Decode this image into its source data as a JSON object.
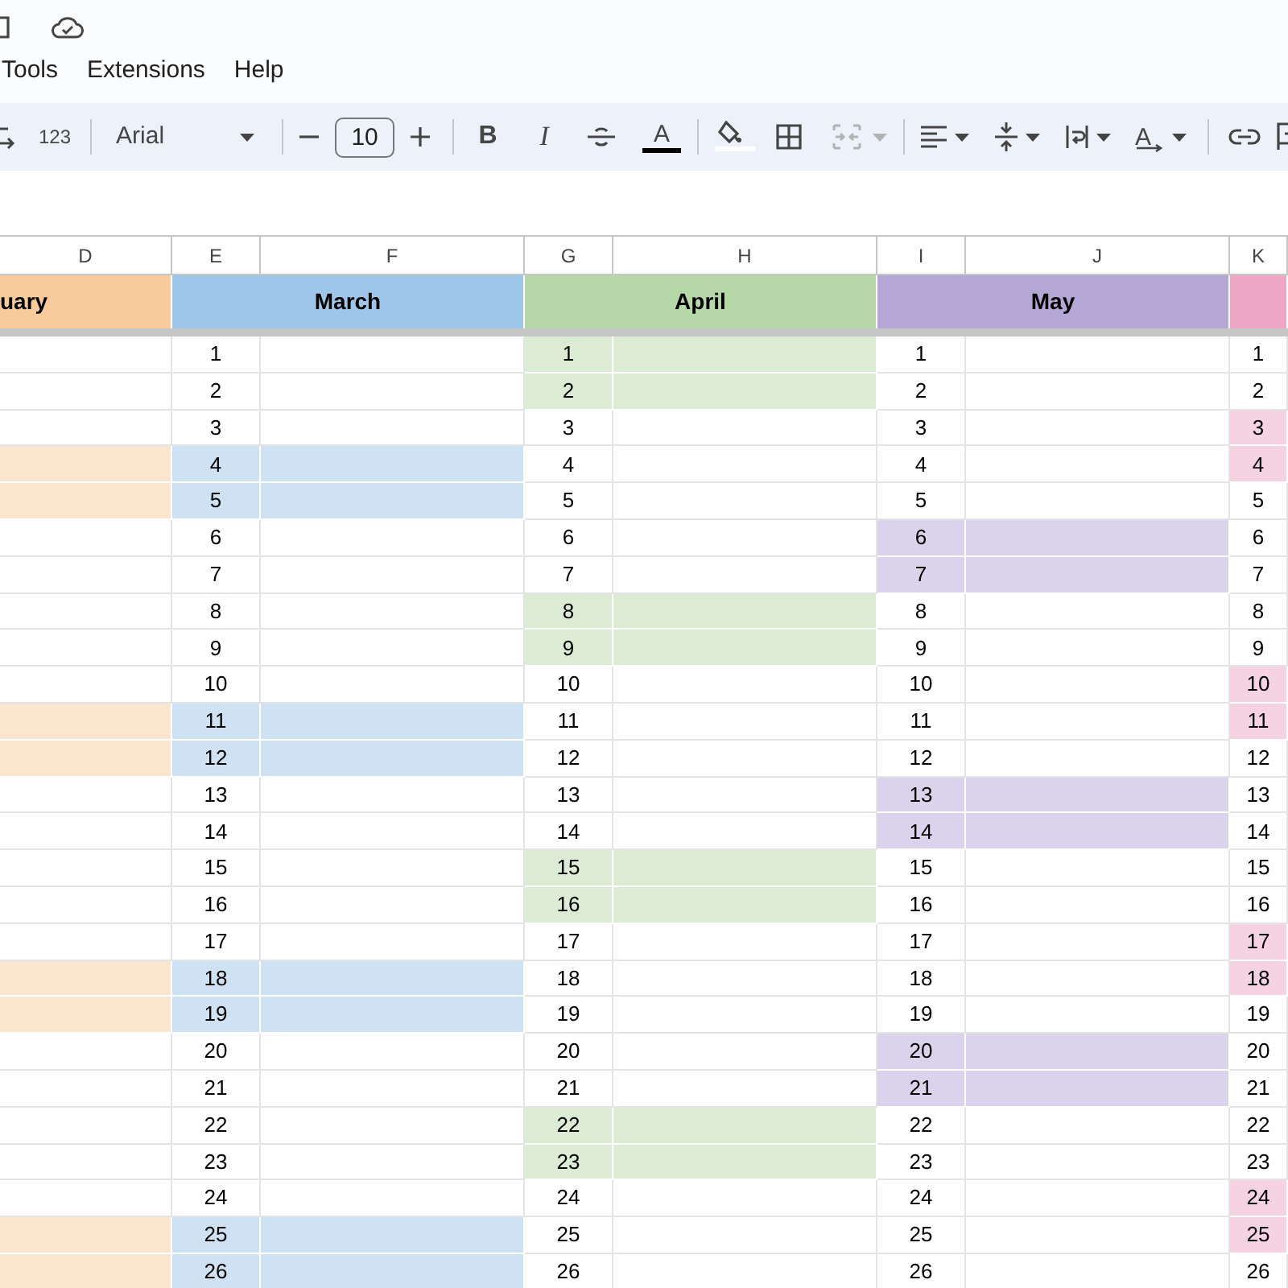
{
  "menu": [
    "Tools",
    "Extensions",
    "Help"
  ],
  "toolbar": {
    "number_format": "123",
    "font": "Arial",
    "font_size": "10",
    "bold": "B",
    "italic": "I",
    "text_color": "A",
    "rotate": "A",
    "merge_disabled": true
  },
  "column_headers": [
    "D",
    "E",
    "F",
    "G",
    "H",
    "I",
    "J",
    "K"
  ],
  "months": [
    {
      "kind": "tail",
      "name": "uary",
      "color": "#f9cb9c",
      "days": [
        {
          "highlighted": false
        },
        {
          "highlighted": false
        },
        {
          "highlighted": false
        },
        {
          "highlighted": true
        },
        {
          "highlighted": true
        },
        {
          "highlighted": false
        },
        {
          "highlighted": false
        },
        {
          "highlighted": false
        },
        {
          "highlighted": false
        },
        {
          "highlighted": false
        },
        {
          "highlighted": true
        },
        {
          "highlighted": true
        },
        {
          "highlighted": false
        },
        {
          "highlighted": false
        },
        {
          "highlighted": false
        },
        {
          "highlighted": false
        },
        {
          "highlighted": false
        },
        {
          "highlighted": true
        },
        {
          "highlighted": true
        },
        {
          "highlighted": false
        },
        {
          "highlighted": false
        },
        {
          "highlighted": false
        },
        {
          "highlighted": false
        },
        {
          "highlighted": false
        },
        {
          "highlighted": true
        },
        {
          "highlighted": true
        }
      ]
    },
    {
      "kind": "full",
      "name": "March",
      "color": "#9fc5e8",
      "days": [
        {
          "day": "1",
          "highlighted": false
        },
        {
          "day": "2",
          "highlighted": false
        },
        {
          "day": "3",
          "highlighted": false
        },
        {
          "day": "4",
          "highlighted": true
        },
        {
          "day": "5",
          "highlighted": true
        },
        {
          "day": "6",
          "highlighted": false
        },
        {
          "day": "7",
          "highlighted": false
        },
        {
          "day": "8",
          "highlighted": false
        },
        {
          "day": "9",
          "highlighted": false
        },
        {
          "day": "10",
          "highlighted": false
        },
        {
          "day": "11",
          "highlighted": true
        },
        {
          "day": "12",
          "highlighted": true
        },
        {
          "day": "13",
          "highlighted": false
        },
        {
          "day": "14",
          "highlighted": false
        },
        {
          "day": "15",
          "highlighted": false
        },
        {
          "day": "16",
          "highlighted": false
        },
        {
          "day": "17",
          "highlighted": false
        },
        {
          "day": "18",
          "highlighted": true
        },
        {
          "day": "19",
          "highlighted": true
        },
        {
          "day": "20",
          "highlighted": false
        },
        {
          "day": "21",
          "highlighted": false
        },
        {
          "day": "22",
          "highlighted": false
        },
        {
          "day": "23",
          "highlighted": false
        },
        {
          "day": "24",
          "highlighted": false
        },
        {
          "day": "25",
          "highlighted": true
        },
        {
          "day": "26",
          "highlighted": true
        }
      ]
    },
    {
      "kind": "full",
      "name": "April",
      "color": "#b6d7a8",
      "days": [
        {
          "day": "1",
          "highlighted": true
        },
        {
          "day": "2",
          "highlighted": true
        },
        {
          "day": "3",
          "highlighted": false
        },
        {
          "day": "4",
          "highlighted": false
        },
        {
          "day": "5",
          "highlighted": false
        },
        {
          "day": "6",
          "highlighted": false
        },
        {
          "day": "7",
          "highlighted": false
        },
        {
          "day": "8",
          "highlighted": true
        },
        {
          "day": "9",
          "highlighted": true
        },
        {
          "day": "10",
          "highlighted": false
        },
        {
          "day": "11",
          "highlighted": false
        },
        {
          "day": "12",
          "highlighted": false
        },
        {
          "day": "13",
          "highlighted": false
        },
        {
          "day": "14",
          "highlighted": false
        },
        {
          "day": "15",
          "highlighted": true
        },
        {
          "day": "16",
          "highlighted": true
        },
        {
          "day": "17",
          "highlighted": false
        },
        {
          "day": "18",
          "highlighted": false
        },
        {
          "day": "19",
          "highlighted": false
        },
        {
          "day": "20",
          "highlighted": false
        },
        {
          "day": "21",
          "highlighted": false
        },
        {
          "day": "22",
          "highlighted": true
        },
        {
          "day": "23",
          "highlighted": true
        },
        {
          "day": "24",
          "highlighted": false
        },
        {
          "day": "25",
          "highlighted": false
        },
        {
          "day": "26",
          "highlighted": false
        }
      ]
    },
    {
      "kind": "full",
      "name": "May",
      "color": "#b4a7d6",
      "days": [
        {
          "day": "1",
          "highlighted": false
        },
        {
          "day": "2",
          "highlighted": false
        },
        {
          "day": "3",
          "highlighted": false
        },
        {
          "day": "4",
          "highlighted": false
        },
        {
          "day": "5",
          "highlighted": false
        },
        {
          "day": "6",
          "highlighted": true
        },
        {
          "day": "7",
          "highlighted": true
        },
        {
          "day": "8",
          "highlighted": false
        },
        {
          "day": "9",
          "highlighted": false
        },
        {
          "day": "10",
          "highlighted": false
        },
        {
          "day": "11",
          "highlighted": false
        },
        {
          "day": "12",
          "highlighted": false
        },
        {
          "day": "13",
          "highlighted": true
        },
        {
          "day": "14",
          "highlighted": true
        },
        {
          "day": "15",
          "highlighted": false
        },
        {
          "day": "16",
          "highlighted": false
        },
        {
          "day": "17",
          "highlighted": false
        },
        {
          "day": "18",
          "highlighted": false
        },
        {
          "day": "19",
          "highlighted": false
        },
        {
          "day": "20",
          "highlighted": true
        },
        {
          "day": "21",
          "highlighted": true
        },
        {
          "day": "22",
          "highlighted": false
        },
        {
          "day": "23",
          "highlighted": false
        },
        {
          "day": "24",
          "highlighted": false
        },
        {
          "day": "25",
          "highlighted": false
        },
        {
          "day": "26",
          "highlighted": false
        }
      ]
    },
    {
      "kind": "head",
      "color": "#eda6c4",
      "days": [
        {
          "day": "1",
          "highlighted": false
        },
        {
          "day": "2",
          "highlighted": false
        },
        {
          "day": "3",
          "highlighted": true
        },
        {
          "day": "4",
          "highlighted": true
        },
        {
          "day": "5",
          "highlighted": false
        },
        {
          "day": "6",
          "highlighted": false
        },
        {
          "day": "7",
          "highlighted": false
        },
        {
          "day": "8",
          "highlighted": false
        },
        {
          "day": "9",
          "highlighted": false
        },
        {
          "day": "10",
          "highlighted": true
        },
        {
          "day": "11",
          "highlighted": true
        },
        {
          "day": "12",
          "highlighted": false
        },
        {
          "day": "13",
          "highlighted": false
        },
        {
          "day": "14",
          "highlighted": false
        },
        {
          "day": "15",
          "highlighted": false
        },
        {
          "day": "16",
          "highlighted": false
        },
        {
          "day": "17",
          "highlighted": true
        },
        {
          "day": "18",
          "highlighted": true
        },
        {
          "day": "19",
          "highlighted": false
        },
        {
          "day": "20",
          "highlighted": false
        },
        {
          "day": "21",
          "highlighted": false
        },
        {
          "day": "22",
          "highlighted": false
        },
        {
          "day": "23",
          "highlighted": false
        },
        {
          "day": "24",
          "highlighted": true
        },
        {
          "day": "25",
          "highlighted": true
        },
        {
          "day": "26",
          "highlighted": false
        }
      ]
    }
  ]
}
